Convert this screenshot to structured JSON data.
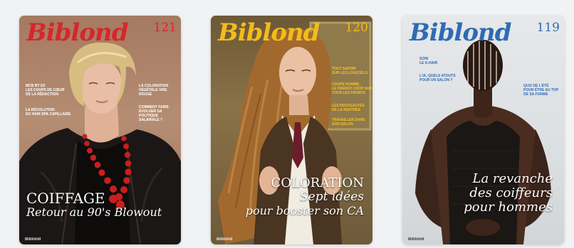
{
  "covers": [
    {
      "masthead": "Biblond",
      "issue": "121",
      "masthead_color": "#d8262b",
      "teasers_left": [
        "MCB BY D2\nLES COUPS DE CŒUR\nDE LA RÉDACTION",
        "LA RÉVOLUTION\nDU HAIR SPA CAPILLAIRE"
      ],
      "teasers_right": [
        "LA COLORATION\nVÉGÉTALE VIRE ROUGE",
        "COMMENT FAIRE\nÉVOLUER SA POLITIQUE\nSALARIALE ?"
      ],
      "headline_1": "COIFFAGE",
      "headline_2": "Retour au 90's Blowout",
      "footer": "Biblond"
    },
    {
      "masthead": "Biblond",
      "issue": "120",
      "masthead_color": "#f2bc1c",
      "teasers_right": [
        "TOUT SAVOIR\nSUR LES LOGICIELS",
        "COUPE HOMME,\nLE FRENCH CROP SUR\nTOUS LES FRONTS",
        "LES NOUVEAUTÉS\nDE LA RENTRÉE",
        "TRAVAILLER DANS\nSON SALON"
      ],
      "headline_1": "COLORATION",
      "headline_2": "Sept idées",
      "headline_3": "pour booster son CA",
      "footer": "Biblond"
    },
    {
      "masthead": "Biblond",
      "issue": "119",
      "masthead_color": "#2f6bb3",
      "teasers_left": [
        "SOIN\nLE K-HAIR",
        "L'IA, QUELS ATOUTS\nPOUR UN SALON ?"
      ],
      "teasers_right": [
        "QUIZ DE L'ÉTÉ\nPOUR ÊTRE AU TOP\nDE SA FORME"
      ],
      "headline_1": "La revanche",
      "headline_2": "des coiffeurs",
      "headline_3": "pour hommes",
      "footer": "Biblond"
    }
  ]
}
